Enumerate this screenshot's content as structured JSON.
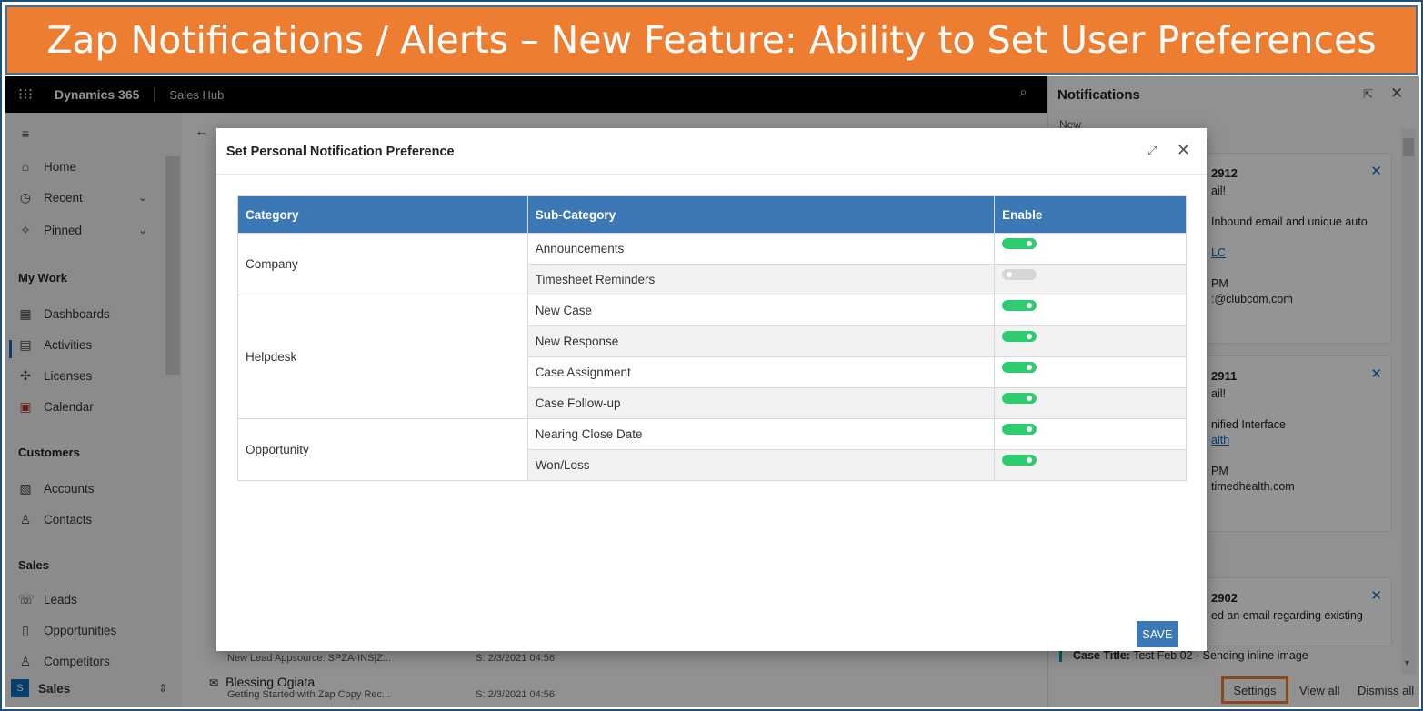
{
  "banner": {
    "text": "Zap Notifications / Alerts – New Feature: Ability to Set User Preferences"
  },
  "topbar": {
    "app_name": "Dynamics 365",
    "hub_name": "Sales Hub"
  },
  "sidebar": {
    "top_items": [
      {
        "label": "Home",
        "icon": "home-icon"
      },
      {
        "label": "Recent",
        "icon": "clock-icon"
      },
      {
        "label": "Pinned",
        "icon": "pin-icon"
      }
    ],
    "sections": [
      {
        "heading": "My Work",
        "items": [
          {
            "label": "Dashboards",
            "icon": "dashboard-icon"
          },
          {
            "label": "Activities",
            "icon": "clipboard-icon"
          },
          {
            "label": "Licenses",
            "icon": "puzzle-icon"
          },
          {
            "label": "Calendar",
            "icon": "calendar-icon"
          }
        ]
      },
      {
        "heading": "Customers",
        "items": [
          {
            "label": "Accounts",
            "icon": "building-icon"
          },
          {
            "label": "Contacts",
            "icon": "person-icon"
          }
        ]
      },
      {
        "heading": "Sales",
        "items": [
          {
            "label": "Leads",
            "icon": "phone-icon"
          },
          {
            "label": "Opportunities",
            "icon": "document-icon"
          },
          {
            "label": "Competitors",
            "icon": "person-icon"
          }
        ]
      }
    ],
    "area_switcher": {
      "badge": "S",
      "label": "Sales"
    }
  },
  "background_list": [
    {
      "title": "",
      "subtitle": "New Lead Appsource: SPZA-INS|Z...",
      "date": "S: 2/3/2021 04:56"
    },
    {
      "title": "Blessing Ogiata",
      "subtitle": "Getting Started with Zap Copy Rec...",
      "date": "S: 2/3/2021 04:56"
    }
  ],
  "notifications": {
    "title": "Notifications",
    "group_label": "New",
    "cards": [
      {
        "title": "2912",
        "lines": [
          "ail!",
          "Inbound email and unique auto",
          "LC",
          "PM",
          ":@clubcom.com"
        ],
        "link_index": 2
      },
      {
        "title": "2911",
        "lines": [
          "ail!",
          "nified Interface",
          "alth",
          "PM",
          "timedhealth.com"
        ],
        "link_index": 2
      },
      {
        "title": "2902",
        "lines": [
          "ed an email regarding existing"
        ],
        "link_index": -1
      }
    ],
    "case_line": {
      "label": "Case Title:",
      "value": "Test Feb 02 - Sending inline image"
    },
    "footer": {
      "settings": "Settings",
      "view_all": "View all",
      "dismiss_all": "Dismiss all"
    }
  },
  "modal": {
    "title": "Set Personal Notification Preference",
    "columns": [
      "Category",
      "Sub-Category",
      "Enable"
    ],
    "rows": [
      {
        "category": "Company",
        "rowspan": 2,
        "sub": "Announcements",
        "enabled": true
      },
      {
        "category": null,
        "sub": "Timesheet Reminders",
        "enabled": false
      },
      {
        "category": "Helpdesk",
        "rowspan": 4,
        "sub": "New Case",
        "enabled": true
      },
      {
        "category": null,
        "sub": "New Response",
        "enabled": true
      },
      {
        "category": null,
        "sub": "Case Assignment",
        "enabled": true
      },
      {
        "category": null,
        "sub": "Case Follow-up",
        "enabled": true
      },
      {
        "category": "Opportunity",
        "rowspan": 2,
        "sub": "Nearing Close Date",
        "enabled": true
      },
      {
        "category": null,
        "sub": "Won/Loss",
        "enabled": true
      }
    ],
    "save_label": "SAVE"
  },
  "colors": {
    "banner": "#ed7d31",
    "header": "#3c78b5",
    "toggle_on": "#2ecc71",
    "toggle_off": "#d6d6d6"
  }
}
